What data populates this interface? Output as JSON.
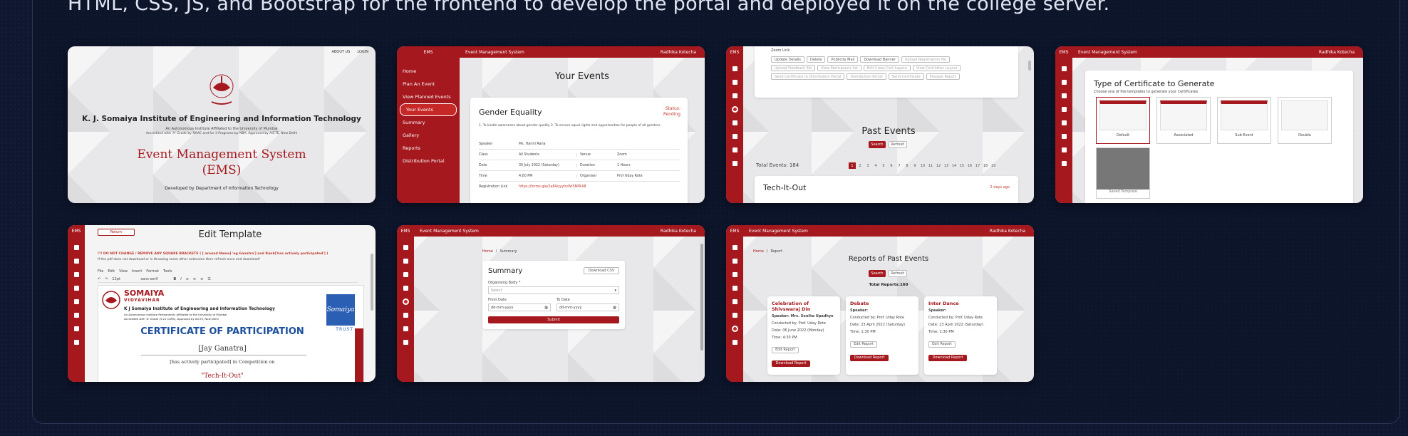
{
  "description": "HTML, CSS, JS, and Bootstrap for the frontend to develop the portal and deployed it on the college server.",
  "landing": {
    "nav": [
      "ABOUT US",
      "LOGIN"
    ],
    "institute": "K. J. Somaiya Institute of Engineering and Information Technology",
    "sub1": "An Autonomous Institute Affiliated to the University of Mumbai",
    "sub2": "Accredited with 'A' Grade by NAAC and for 3 Programs by NBA. Approved by AICTE, New Delhi",
    "title_line1": "Event Management System",
    "title_line2": "(EMS)",
    "footer": "Developed by Department of Information Technology"
  },
  "app": {
    "brand": "EMS",
    "name": "Event Management System",
    "user": "Radhika Kotecha"
  },
  "your_events": {
    "nav": [
      "Home",
      "Plan An Event",
      "View Planned Events",
      "Your Events",
      "Summary",
      "Gallery",
      "Reports",
      "Distribution Portal"
    ],
    "heading": "Your Events",
    "event_title": "Gender Equality",
    "status_label": "Status:",
    "status_value": "Pending",
    "objectives": "1. To kindle awareness about gender quality 2. To ensure equal rights and opportunities for people of all genders.",
    "rows": [
      {
        "k1": "Speaker",
        "v1": "Ms. Harini Rana",
        "k2": "",
        "v2": ""
      },
      {
        "k1": "Class",
        "v1": "All Students",
        "k2": "Venue",
        "v2": "Zoom"
      },
      {
        "k1": "Date",
        "v1": "30 July 2022 (Saturday)",
        "k2": "Duration",
        "v2": "1 Hours"
      },
      {
        "k1": "Time",
        "v1": "4:00 PM",
        "k2": "Organiser",
        "v2": "Prof Uday Rote"
      }
    ],
    "reg_label": "Registration Link",
    "reg_value": "https://forms.gle/2a8AcjyyhvWrSNPKA8"
  },
  "past_events": {
    "zoom_label": "Zoom Link",
    "buttons1": [
      "Update Details",
      "Delete",
      "Publicity Mail",
      "Download Banner",
      "Upload Registration file",
      "Upload Feedback file"
    ],
    "buttons2": [
      "View Participants list",
      "Edit Cross-Cert Layout",
      "View Cert/other Layout",
      "Send Certificate to Distribution Portal",
      "Distribution Portal"
    ],
    "buttons3": [
      "Send Certificate",
      "Prepare Report"
    ],
    "heading": "Past Events",
    "search": "Search",
    "refresh": "Refresh",
    "total": "Total Events: 184",
    "pages": [
      "1",
      "2",
      "3",
      "4",
      "5",
      "6",
      "7",
      "8",
      "9",
      "10",
      "11",
      "12",
      "13",
      "14",
      "15",
      "16",
      "17",
      "18",
      "19"
    ],
    "event_title": "Tech-It-Out",
    "ago": "2 days ago"
  },
  "certificate": {
    "heading": "Type of Certificate to Generate",
    "sub": "Choose one of the templates to generate your Certificates",
    "templates": [
      "Default",
      "Associated",
      "Sub Event",
      "Double"
    ],
    "saved": "Saved Template"
  },
  "edit_template": {
    "back": "Return",
    "heading": "Edit Template",
    "warn1": "!!! DO NOT CHANGE / REMOVE ANY SQUARE BRACKETS ( [ around Name] 'eg Ganatra'] and Rank['has actively participated'] )",
    "warn2": "If the pdf does not download or is throwing some other extension then refresh once and download!",
    "menu": [
      "File",
      "Edit",
      "View",
      "Insert",
      "Format",
      "Tools"
    ],
    "font_size": "12pt",
    "font_family": "sans-serif",
    "logo_text": "SOMAIYA",
    "logo_sub": "VIDYAVIHAR",
    "inst": "K J Somaiya Institute of Engineering and Information Technology",
    "inst_sub1": "An Autonomous Institute Permanently Affiliated to the University of Mumbai",
    "inst_sub2": "Accredited with 'A' Grade (3.21 CGPA), Approved by AICTE, New Delhi",
    "cert_title": "CERTIFICATE OF PARTICIPATION",
    "name": "[Jay Ganatra]",
    "line": "[has actively participated] in Competition on",
    "event": "\"Tech-It-Out\"",
    "trust_text": "Somaiya",
    "trust": "TRUST"
  },
  "summary": {
    "crumb_home": "Home",
    "crumb_sep": "/",
    "crumb_page": "Summary",
    "heading": "Summary",
    "download": "Download CSV",
    "org_label": "Organising Body *",
    "org_placeholder": "Select",
    "from_label": "From Date",
    "to_label": "To Date",
    "date_placeholder": "dd-mm-yyyy",
    "submit": "Submit"
  },
  "reports": {
    "crumb_home": "Home",
    "crumb_sep": "/",
    "crumb_page": "Report",
    "heading": "Reports of Past Events",
    "search": "Search",
    "refresh": "Refresh",
    "total": "Total Reports:160",
    "cards": [
      {
        "title": "Celebration of Shivswaraj Din",
        "l1": "Speaker: Mrs. Soniha Upadhye",
        "l2": "Conducted by: Prof. Uday Rote",
        "l3": "Date: 06 June 2022 (Monday)",
        "l4": "Time: 4:30 PM"
      },
      {
        "title": "Debate",
        "l1": "Speaker:",
        "l2": "Conducted by: Prof. Uday Rote",
        "l3": "Date: 23 April 2022 (Saturday)",
        "l4": "Time: 1:30 PM"
      },
      {
        "title": "Inter Dance",
        "l1": "Speaker:",
        "l2": "Conducted by: Prof. Uday Rote",
        "l3": "Date: 23 April 2022 (Saturday)",
        "l4": "Time: 2:30 PM"
      }
    ],
    "edit": "Edit Report",
    "download": "Download Report"
  }
}
